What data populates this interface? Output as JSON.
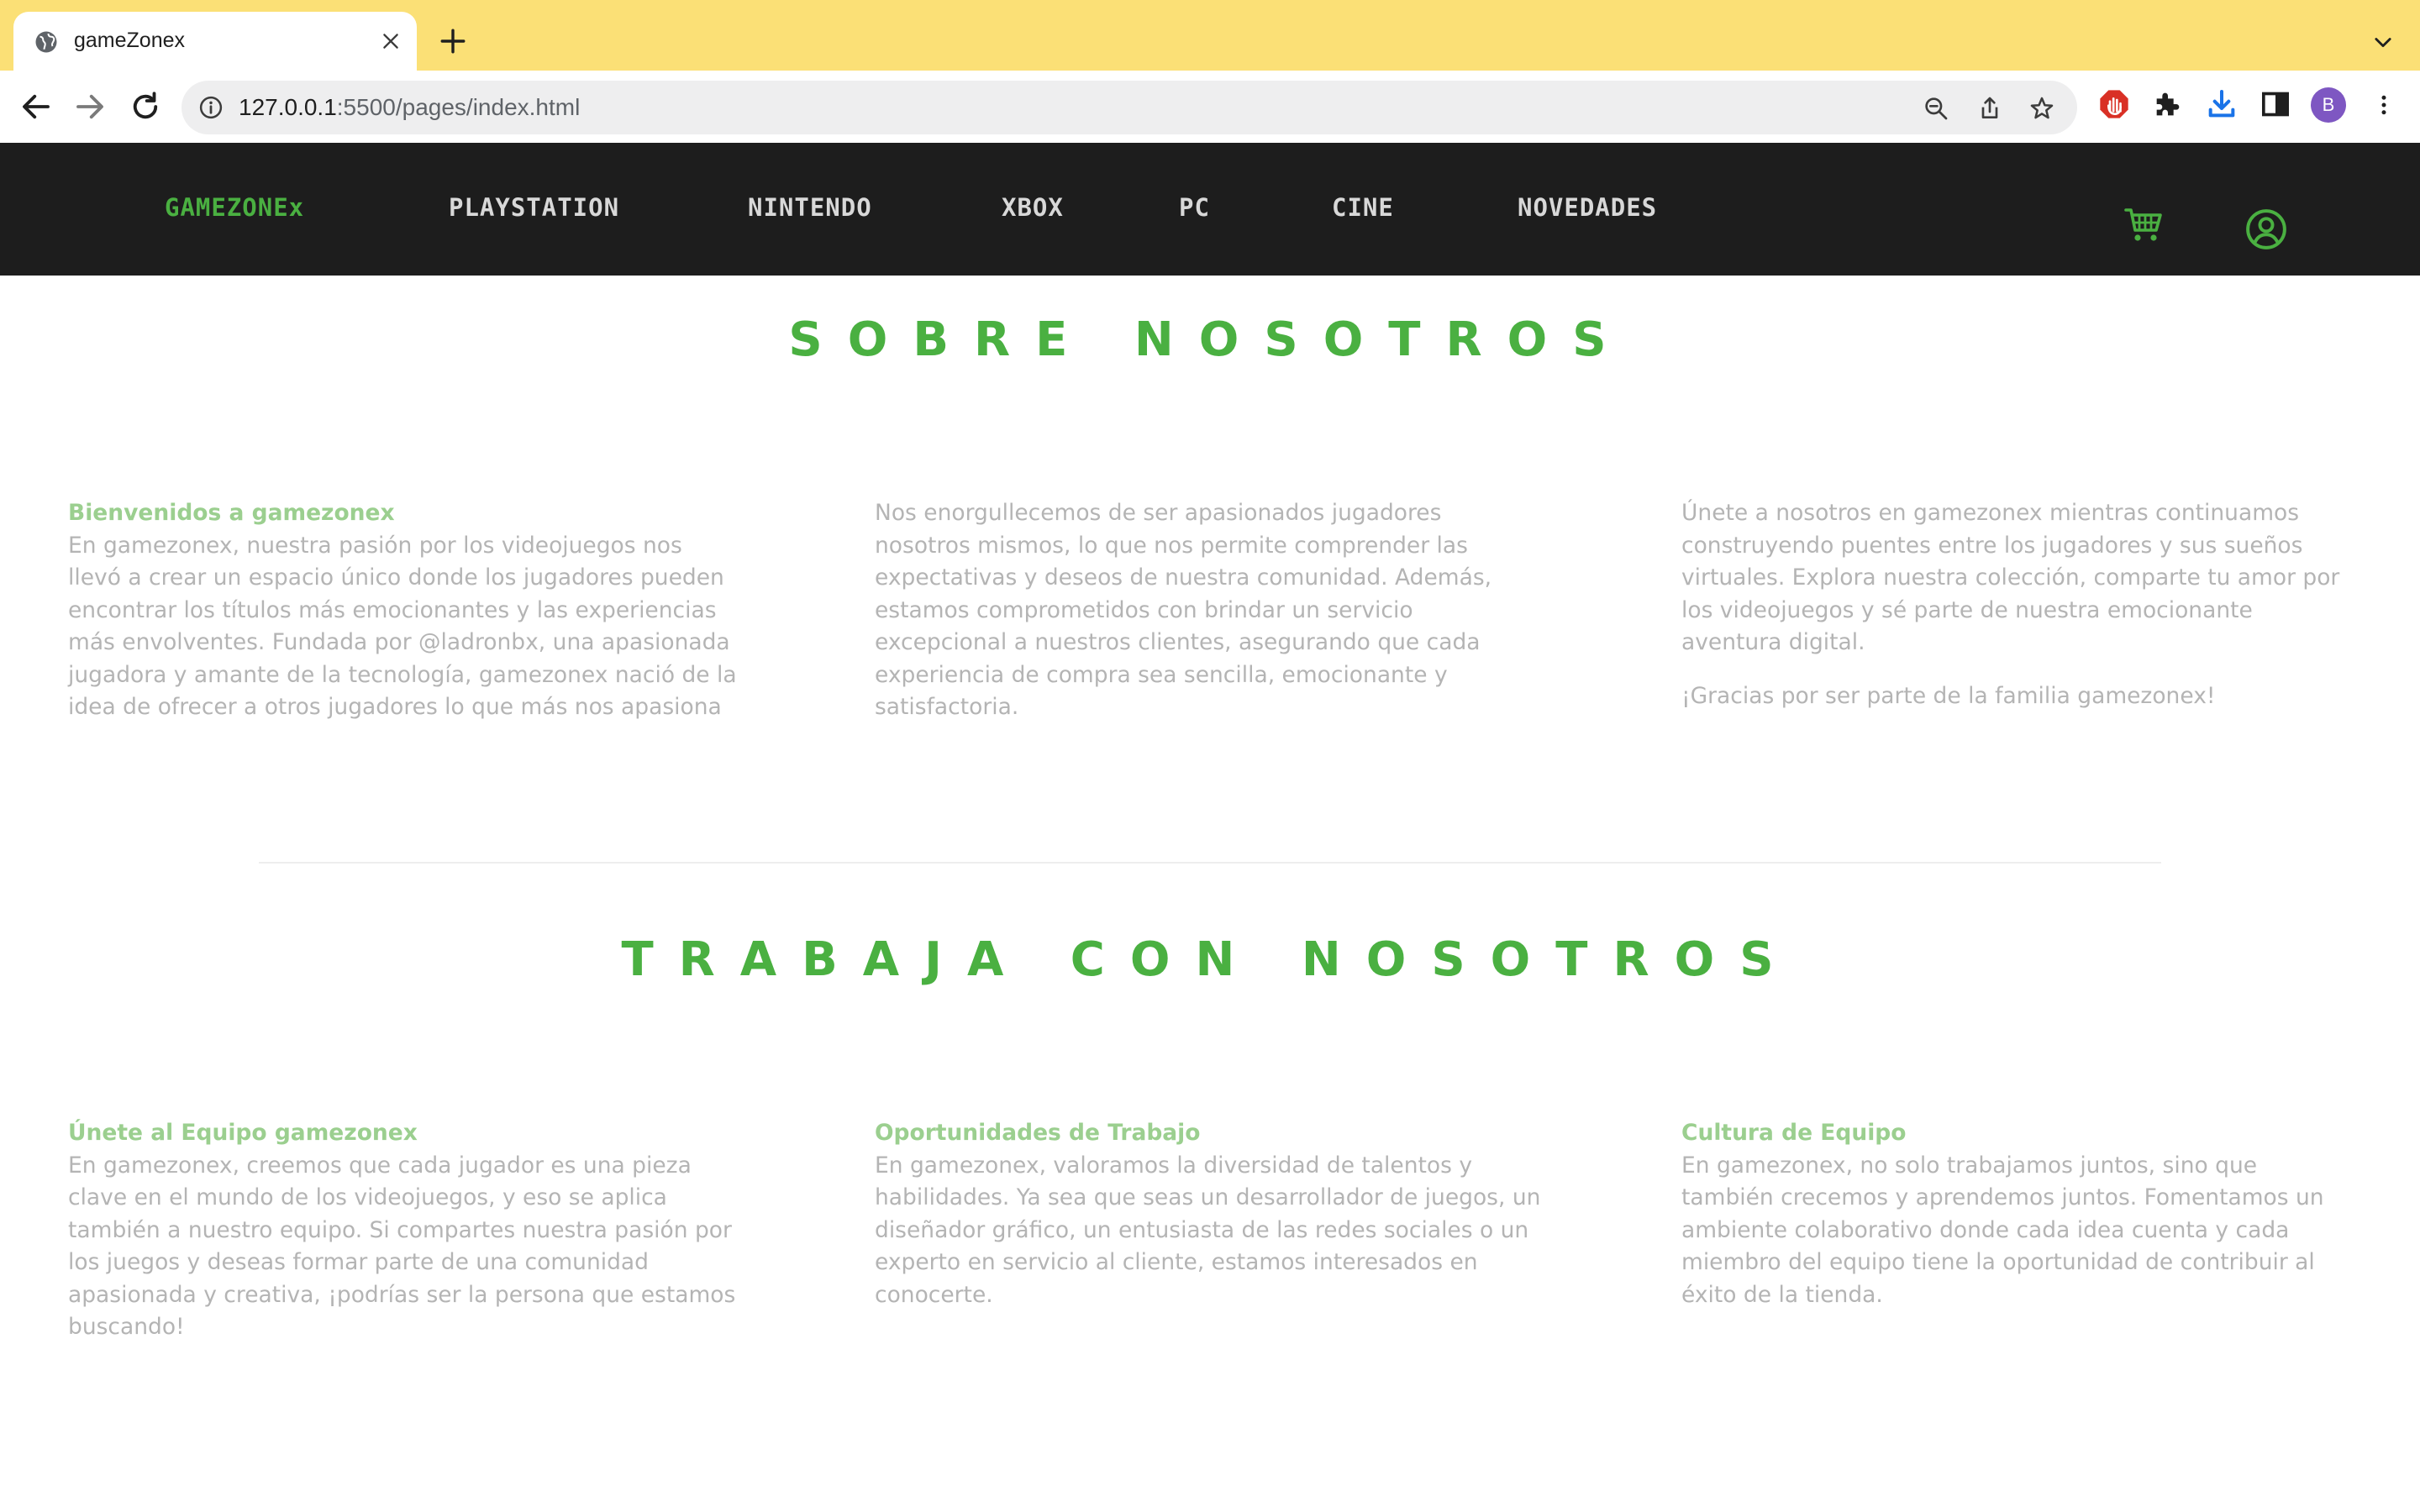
{
  "browser": {
    "tab": {
      "title": "gameZonex",
      "favicon": "globe-icon"
    },
    "url": {
      "host": "127.0.0.1",
      "rest": ":5500/pages/index.html"
    },
    "profile_initial": "B",
    "colors": {
      "tabstrip": "#fbe076",
      "avatar": "#7e57c2",
      "ext_red": "#d93025",
      "download_blue": "#1a73e8"
    }
  },
  "site": {
    "colors": {
      "nav_bg": "#1d1d1d",
      "accent": "#4ab041",
      "heading_light": "#9bcf8f",
      "body_text": "#b4b4b4"
    },
    "nav": {
      "brand": "GAMEZONEx",
      "items": [
        "PLAYSTATION",
        "NINTENDO",
        "XBOX",
        "PC",
        "CINE",
        "NOVEDADES"
      ],
      "icons": [
        "cart-icon",
        "user-icon"
      ]
    }
  },
  "about": {
    "title": "SOBRE NOSOTROS",
    "col1": {
      "heading": "Bienvenidos a gamezonex",
      "text": "En gamezonex, nuestra pasión por los videojuegos nos llevó a crear un espacio único donde los jugadores pueden encontrar los títulos más emocionantes y las experiencias más envolventes. Fundada por @ladronbx, una apasionada jugadora y amante de la tecnología, gamezonex nació de la idea de ofrecer a otros jugadores lo que más nos apasiona"
    },
    "col2": {
      "text": "Nos enorgullecemos de ser apasionados jugadores nosotros mismos, lo que nos permite comprender las expectativas y deseos de nuestra comunidad. Además, estamos comprometidos con brindar un servicio excepcional a nuestros clientes, asegurando que cada experiencia de compra sea sencilla, emocionante y satisfactoria."
    },
    "col3": {
      "text": "Únete a nosotros en gamezonex mientras continuamos construyendo puentes entre los jugadores y sus sueños virtuales. Explora nuestra colección, comparte tu amor por los videojuegos y sé parte de nuestra emocionante aventura digital.",
      "thanks": "¡Gracias por ser parte de la familia gamezonex!"
    }
  },
  "work": {
    "title": "TRABAJA CON NOSOTROS",
    "col1": {
      "heading": "Únete al Equipo gamezonex",
      "text": "En gamezonex, creemos que cada jugador es una pieza clave en el mundo de los videojuegos, y eso se aplica también a nuestro equipo. Si compartes nuestra pasión por los juegos y deseas formar parte de una comunidad apasionada y creativa, ¡podrías ser la persona que estamos buscando!"
    },
    "col2": {
      "heading": "Oportunidades de Trabajo",
      "text": "En gamezonex, valoramos la diversidad de talentos y habilidades. Ya sea que seas un desarrollador de juegos, un diseñador gráfico, un entusiasta de las redes sociales o un experto en servicio al cliente, estamos interesados en conocerte."
    },
    "col3": {
      "heading": "Cultura de Equipo",
      "text": "En gamezonex, no solo trabajamos juntos, sino que también crecemos y aprendemos juntos. Fomentamos un ambiente colaborativo donde cada idea cuenta y cada miembro del equipo tiene la oportunidad de contribuir al éxito de la tienda."
    }
  }
}
